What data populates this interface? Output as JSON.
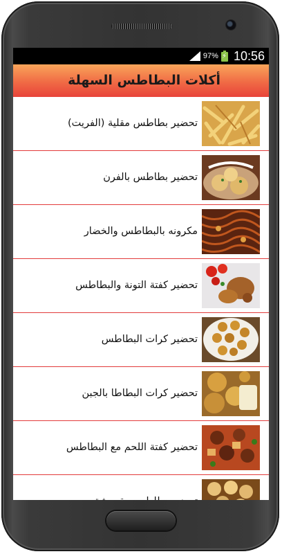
{
  "status_bar": {
    "battery_percent": "97%",
    "time": "10:56",
    "signal_icon": "signal-icon",
    "battery_icon": "battery-charging-icon"
  },
  "app": {
    "title": "أكلات البطاطس السهلة",
    "accent_top": "#f9a55a",
    "accent_bottom": "#e8443a",
    "divider_color": "#e23a3a"
  },
  "recipes": [
    {
      "label": "تحضير بطاطس مقلية (الفريت)",
      "image": "french-fries-image"
    },
    {
      "label": "تحضير بطاطس بالفرن",
      "image": "baked-potatoes-image"
    },
    {
      "label": "مكرونه بالبطاطس والخضار",
      "image": "pasta-potatoes-image"
    },
    {
      "label": "تحضير كفتة التونة والبطاطس",
      "image": "tuna-kofta-image"
    },
    {
      "label": "تحضير كرات البطاطس",
      "image": "potato-balls-image"
    },
    {
      "label": "تحضير كرات البطاطا بالجبن",
      "image": "cheese-potato-balls-image"
    },
    {
      "label": "تحضير كفتة اللحم مع البطاطس",
      "image": "meat-kofta-image"
    },
    {
      "label": "تحضير بطاطس مقرمشة",
      "image": "crispy-potatoes-image"
    }
  ],
  "device": {
    "home_button": "home-button"
  }
}
